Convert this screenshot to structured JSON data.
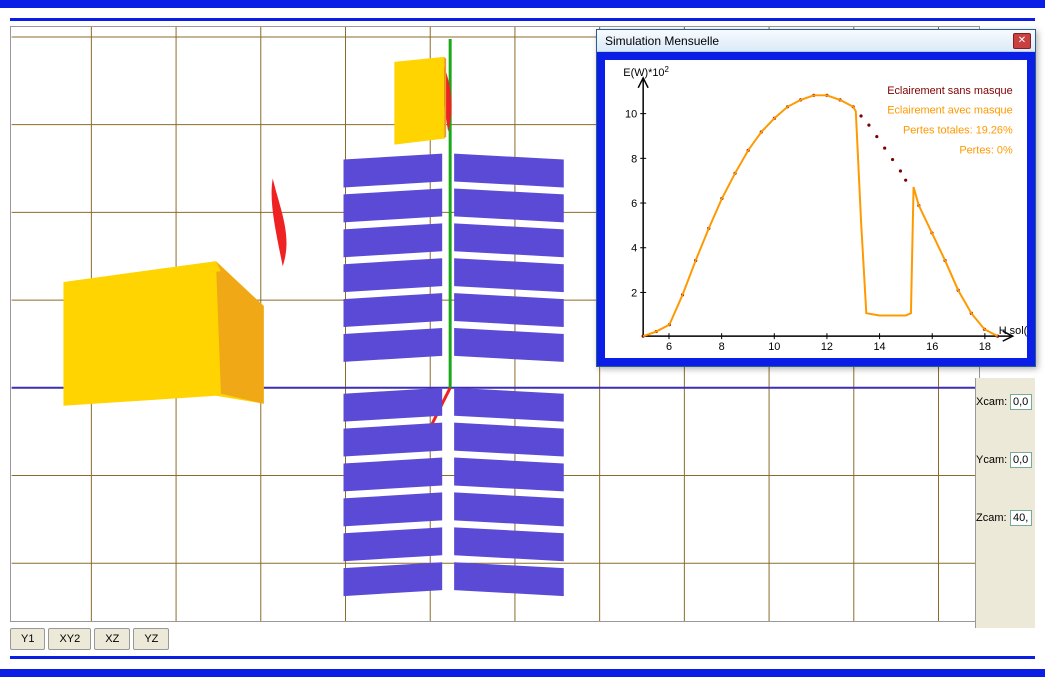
{
  "buttons": {
    "y1": "Y1",
    "xy2": "XY2",
    "xz": "XZ",
    "yz": "YZ"
  },
  "cam": {
    "xlabel": "Xcam:",
    "xval": "0,0",
    "ylabel": "Ycam:",
    "yval": "0,0",
    "zlabel": "Zcam:",
    "zval": "40,"
  },
  "popup": {
    "title": "Simulation Mensuelle",
    "ylabel": "E(W)*10",
    "ylabel_exp": "2",
    "xlabel": "H sol(h)",
    "legend": {
      "sans": "Eclairement sans masque",
      "avec": "Eclairement avec masque",
      "pertes_tot": "Pertes totales: 19.26%",
      "pertes": "Pertes: 0%"
    }
  },
  "chart_data": {
    "type": "line",
    "xlabel": "H sol(h)",
    "ylabel": "E(W)*10^2",
    "xlim": [
      5,
      19
    ],
    "ylim": [
      0,
      11
    ],
    "xticks": [
      6,
      8,
      10,
      12,
      14,
      16,
      18
    ],
    "yticks": [
      2,
      4,
      6,
      8,
      10
    ],
    "series": [
      {
        "name": "Eclairement sans masque",
        "color": "#800000",
        "style": "dotted",
        "x": [
          5.0,
          5.5,
          6.0,
          6.5,
          7.0,
          7.5,
          8.0,
          8.5,
          9.0,
          9.5,
          10.0,
          10.5,
          11.0,
          11.5,
          12.0,
          12.5,
          13.0,
          13.3,
          13.6,
          13.9,
          14.2,
          14.5,
          14.8,
          15.0,
          15.5,
          16.0,
          16.5,
          17.0,
          17.5,
          18.0,
          18.5
        ],
        "y": [
          0.0,
          0.2,
          0.5,
          1.8,
          3.3,
          4.7,
          6.0,
          7.1,
          8.1,
          8.9,
          9.5,
          10.0,
          10.3,
          10.5,
          10.5,
          10.3,
          10.0,
          9.6,
          9.2,
          8.7,
          8.2,
          7.7,
          7.2,
          6.8,
          5.7,
          4.5,
          3.3,
          2.0,
          1.0,
          0.3,
          0.0
        ]
      },
      {
        "name": "Eclairement avec masque",
        "color": "#ff9900",
        "style": "solid",
        "x": [
          5.0,
          5.5,
          6.0,
          6.5,
          7.0,
          7.5,
          8.0,
          8.5,
          9.0,
          9.5,
          10.0,
          10.5,
          11.0,
          11.5,
          12.0,
          12.5,
          13.0,
          13.1,
          13.3,
          13.5,
          14.0,
          15.0,
          15.2,
          15.3,
          15.5,
          16.0,
          16.5,
          17.0,
          17.5,
          18.0,
          18.5
        ],
        "y": [
          0.0,
          0.2,
          0.5,
          1.8,
          3.3,
          4.7,
          6.0,
          7.1,
          8.1,
          8.9,
          9.5,
          10.0,
          10.3,
          10.5,
          10.5,
          10.3,
          10.0,
          9.8,
          5.0,
          1.0,
          0.9,
          0.9,
          1.0,
          6.5,
          5.7,
          4.5,
          3.3,
          2.0,
          1.0,
          0.3,
          0.0
        ]
      }
    ]
  }
}
